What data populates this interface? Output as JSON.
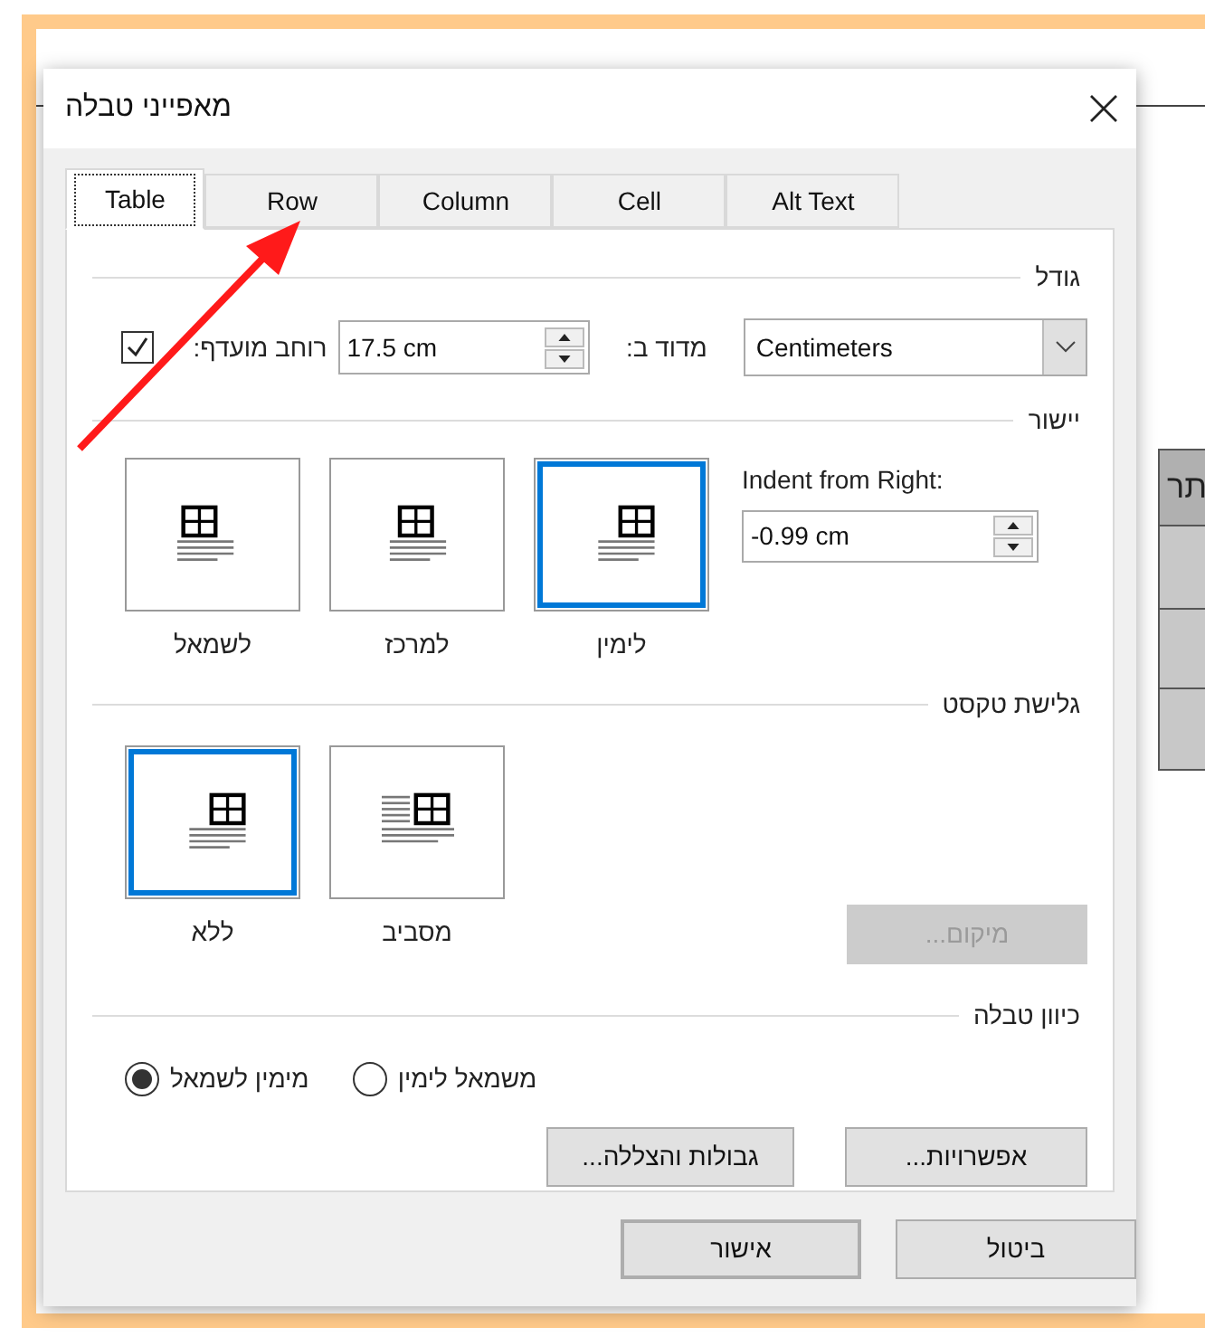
{
  "window": {
    "title": "מאפייני טבלה"
  },
  "tabs": [
    {
      "label": "Alt Text",
      "selected": false
    },
    {
      "label": "Cell",
      "selected": false
    },
    {
      "label": "Column",
      "selected": false
    },
    {
      "label": "Row",
      "selected": false
    },
    {
      "label": "Table",
      "selected": true
    }
  ],
  "size": {
    "heading": "גודל",
    "preferred_width": {
      "label": "רוחב מועדף:",
      "checked": true,
      "value": "17.5 cm"
    },
    "measure_in": {
      "label": "מדוד ב:",
      "value": "Centimeters"
    }
  },
  "alignment": {
    "heading": "יישור",
    "options": [
      {
        "label": "לימין",
        "kind": "right",
        "selected": true
      },
      {
        "label": "למרכז",
        "kind": "center",
        "selected": false
      },
      {
        "label": "לשמאל",
        "kind": "left",
        "selected": false
      }
    ],
    "indent": {
      "label": "Indent from Right:",
      "value": "-0.99 cm"
    }
  },
  "text_wrapping": {
    "heading": "גלישת טקסט",
    "options": [
      {
        "label": "מסביב",
        "kind": "around",
        "selected": false
      },
      {
        "label": "ללא",
        "kind": "none",
        "selected": true
      }
    ],
    "positioning_button": {
      "label": "מיקום...",
      "disabled": true
    }
  },
  "direction": {
    "heading": "כיוון טבלה",
    "options": [
      {
        "label": "משמאל לימין",
        "selected": false
      },
      {
        "label": "מימין לשמאל",
        "selected": true
      }
    ]
  },
  "buttons": [
    "אפשרויות...",
    "גבולות והצללה..."
  ],
  "footer_buttons": [
    {
      "label": "ביטול",
      "kind": "normal"
    },
    {
      "label": "אישור",
      "kind": "default"
    }
  ],
  "background_document": {
    "cell_text": "תר"
  }
}
